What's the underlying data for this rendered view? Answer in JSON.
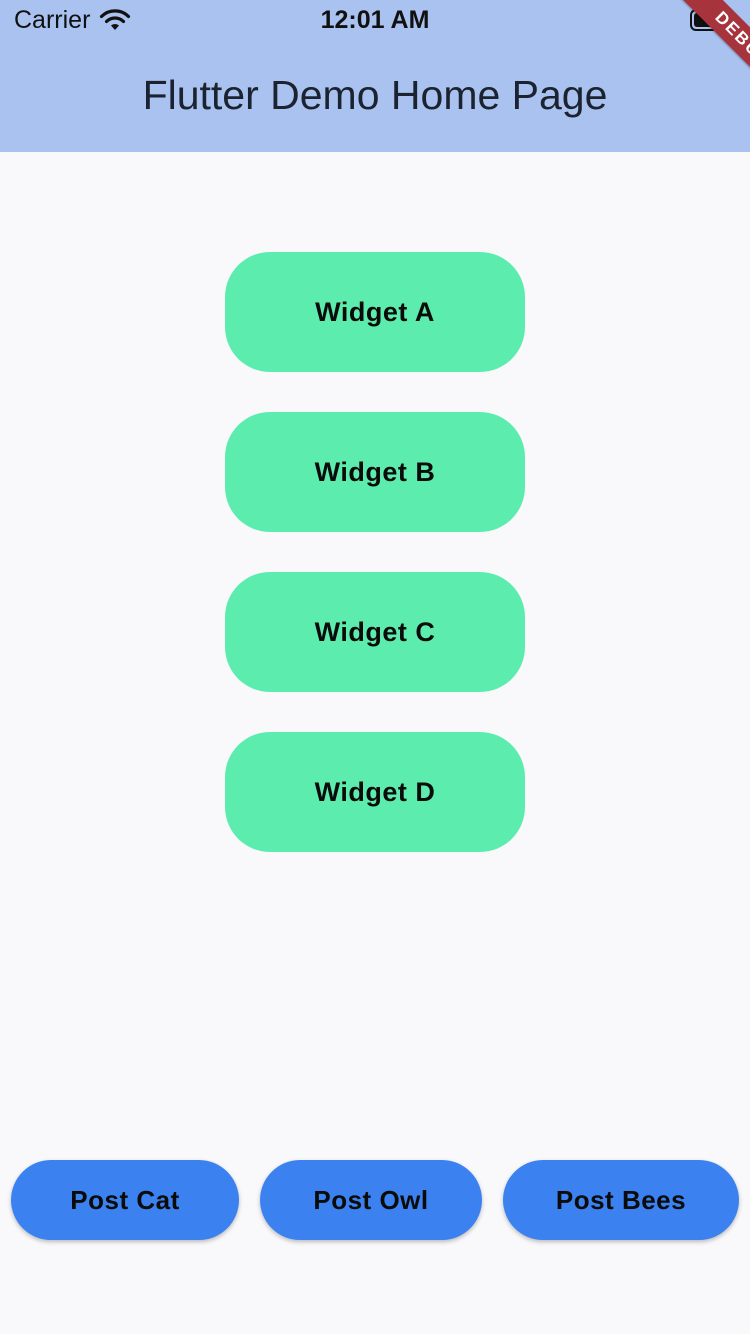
{
  "status_bar": {
    "carrier": "Carrier",
    "time": "12:01 AM"
  },
  "debug_banner": "DEBUG",
  "app_bar": {
    "title": "Flutter Demo Home Page"
  },
  "widgets": [
    {
      "label": "Widget A"
    },
    {
      "label": "Widget B"
    },
    {
      "label": "Widget C"
    },
    {
      "label": "Widget D"
    }
  ],
  "post_buttons": [
    {
      "label": "Post Cat"
    },
    {
      "label": "Post Owl"
    },
    {
      "label": "Post Bees"
    }
  ],
  "colors": {
    "app_bar": "#a9c2ef",
    "widget": "#5cedae",
    "post_button": "#3b82f0",
    "debug_ribbon": "#a7343c"
  }
}
